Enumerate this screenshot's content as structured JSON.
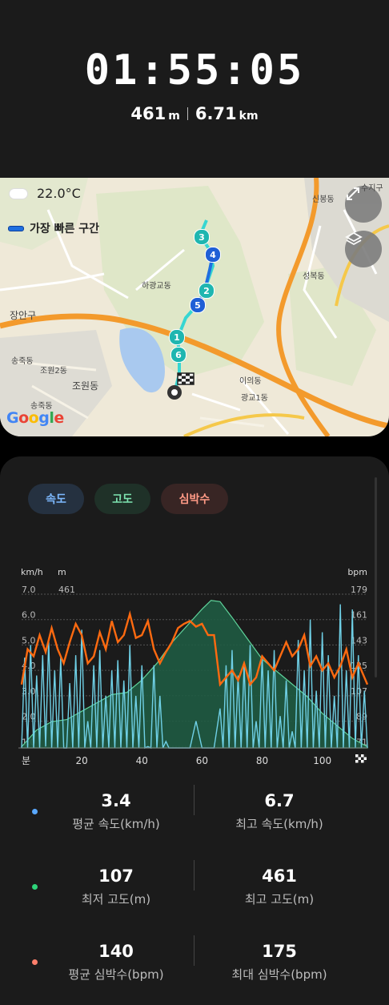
{
  "workout": {
    "duration": "01:55:05",
    "elevation_value": "461",
    "elevation_unit": "m",
    "distance_value": "6.71",
    "distance_unit": "km"
  },
  "map": {
    "weather": "22.0°C",
    "legend_label": "가장 빠른 구간",
    "expand_icon": "expand-icon",
    "layers_icon": "layers-icon",
    "labels": {
      "sinbong": "신봉동",
      "seongbok": "성복동",
      "hagwang": "하광교동",
      "jangan": "장안구",
      "songjuk1": "송죽동",
      "jowon2": "조원2동",
      "jowon": "조원동",
      "songjuk2": "송죽동",
      "iui": "이의동",
      "gwanggyo1": "광교1동",
      "corner": "수지구"
    },
    "markers": [
      "3",
      "4",
      "2",
      "5",
      "1",
      "6"
    ],
    "google_logo": "Google"
  },
  "tabs": [
    {
      "label": "속도",
      "color": "#7db9ff"
    },
    {
      "label": "고도",
      "color": "#7de3b0"
    },
    {
      "label": "심박수",
      "color": "#ff9a86"
    }
  ],
  "chart": {
    "left_units": "km/h",
    "mid_units": "m",
    "right_units": "bpm",
    "x_title": "분",
    "finish_icon": "checkered-flag-icon"
  },
  "chart_data": {
    "type": "line",
    "x_ticks": [
      "20",
      "40",
      "60",
      "80",
      "100"
    ],
    "speed_axis": [
      "7.0",
      "6.0",
      "5.0",
      "4.0",
      "3.0",
      "2.0",
      "1.0"
    ],
    "elevation_axis": [
      "461"
    ],
    "heart_rate_axis": [
      "179",
      "161",
      "143",
      "125",
      "107",
      "89",
      "71"
    ],
    "xlim": [
      0,
      115
    ],
    "speed_ylim": [
      0,
      7.0
    ],
    "elevation_ylim": [
      107,
      461
    ],
    "hr_ylim": [
      53,
      179
    ],
    "series": [
      {
        "name": "고도",
        "color": "#3ea86a",
        "unit": "m",
        "x": [
          0,
          5,
          10,
          15,
          20,
          25,
          30,
          35,
          40,
          45,
          50,
          55,
          60,
          63,
          66,
          70,
          75,
          80,
          85,
          90,
          95,
          100,
          105,
          110,
          115
        ],
        "values": [
          110,
          150,
          170,
          175,
          195,
          215,
          235,
          240,
          270,
          310,
          360,
          400,
          440,
          461,
          458,
          420,
          370,
          320,
          290,
          260,
          230,
          190,
          160,
          130,
          110
        ]
      },
      {
        "name": "심박수",
        "color": "#ff7a1a",
        "unit": "bpm",
        "x": [
          0,
          2,
          4,
          6,
          8,
          10,
          12,
          14,
          16,
          18,
          20,
          22,
          24,
          26,
          28,
          30,
          32,
          34,
          36,
          38,
          40,
          42,
          44,
          46,
          48,
          50,
          52,
          54,
          56,
          58,
          60,
          62,
          64,
          66,
          68,
          70,
          72,
          74,
          76,
          78,
          80,
          82,
          84,
          86,
          88,
          90,
          92,
          94,
          96,
          98,
          100,
          102,
          104,
          106,
          108,
          110,
          112,
          115
        ],
        "values": [
          115,
          140,
          135,
          150,
          138,
          155,
          140,
          130,
          145,
          158,
          150,
          130,
          135,
          152,
          140,
          160,
          145,
          150,
          165,
          148,
          150,
          160,
          140,
          130,
          138,
          145,
          155,
          158,
          160,
          156,
          158,
          150,
          150,
          115,
          120,
          125,
          118,
          130,
          115,
          120,
          135,
          130,
          125,
          135,
          145,
          135,
          140,
          150,
          128,
          135,
          125,
          130,
          120,
          128,
          140,
          120,
          130,
          115
        ]
      },
      {
        "name": "속도",
        "color": "#5fc8de",
        "unit": "km/h",
        "x": [
          0,
          1,
          2,
          3,
          4,
          5,
          6,
          7,
          8,
          9,
          10,
          11,
          12,
          13,
          14,
          15,
          16,
          17,
          18,
          19,
          20,
          21,
          22,
          23,
          24,
          25,
          26,
          27,
          28,
          29,
          30,
          31,
          32,
          33,
          34,
          35,
          36,
          37,
          38,
          39,
          40,
          41,
          42,
          43,
          44,
          45,
          46,
          47,
          48,
          49,
          50,
          52,
          54,
          56,
          58,
          60,
          62,
          64,
          66,
          67,
          68,
          69,
          70,
          71,
          72,
          73,
          74,
          75,
          76,
          77,
          78,
          79,
          80,
          81,
          82,
          83,
          84,
          85,
          86,
          87,
          88,
          89,
          90,
          91,
          92,
          93,
          94,
          95,
          96,
          97,
          98,
          99,
          100,
          101,
          102,
          103,
          104,
          105,
          106,
          107,
          108,
          109,
          110,
          111,
          112,
          113,
          114,
          115
        ],
        "values": [
          0.4,
          4.5,
          0.3,
          5.0,
          0.5,
          3.8,
          0.2,
          4.6,
          1.0,
          5.2,
          0.4,
          4.0,
          0.3,
          4.5,
          0.6,
          0.2,
          3.5,
          0.4,
          4.6,
          0.3,
          5.6,
          0.5,
          2.0,
          0.3,
          4.2,
          0.4,
          4.8,
          0.5,
          3.0,
          0.2,
          4.0,
          0.6,
          4.4,
          0.3,
          3.6,
          0.3,
          5.0,
          0.4,
          3.0,
          0.2,
          4.2,
          0.3,
          1.0,
          0.5,
          4.2,
          0.2,
          3.0,
          0.4,
          1.2,
          0.3,
          0.5,
          0.3,
          0.4,
          0.2,
          2.0,
          0.4,
          0.6,
          0.3,
          2.5,
          0.4,
          4.2,
          0.3,
          4.8,
          0.5,
          3.8,
          0.4,
          4.2,
          0.3,
          5.0,
          0.4,
          2.0,
          0.3,
          4.6,
          0.5,
          4.0,
          0.3,
          4.8,
          0.4,
          2.2,
          0.3,
          3.6,
          0.4,
          1.6,
          0.3,
          5.2,
          0.5,
          4.0,
          0.3,
          6.0,
          0.4,
          3.2,
          0.3,
          5.5,
          0.4,
          4.6,
          0.3,
          3.0,
          0.4,
          6.6,
          0.3,
          4.0,
          0.5,
          6.4,
          0.4,
          4.6,
          0.3,
          3.2,
          0.5
        ]
      }
    ]
  },
  "stats": [
    {
      "value": "3.4",
      "label": "평균 속도(km/h)",
      "dot": "#5aa8ff"
    },
    {
      "value": "6.7",
      "label": "최고 속도(km/h)"
    },
    {
      "value": "107",
      "label": "최저 고도(m)",
      "dot": "#2ed47a"
    },
    {
      "value": "461",
      "label": "최고 고도(m)"
    },
    {
      "value": "140",
      "label": "평균 심박수(bpm)",
      "dot": "#ff7f6b"
    },
    {
      "value": "175",
      "label": "최대 심박수(bpm)"
    }
  ]
}
